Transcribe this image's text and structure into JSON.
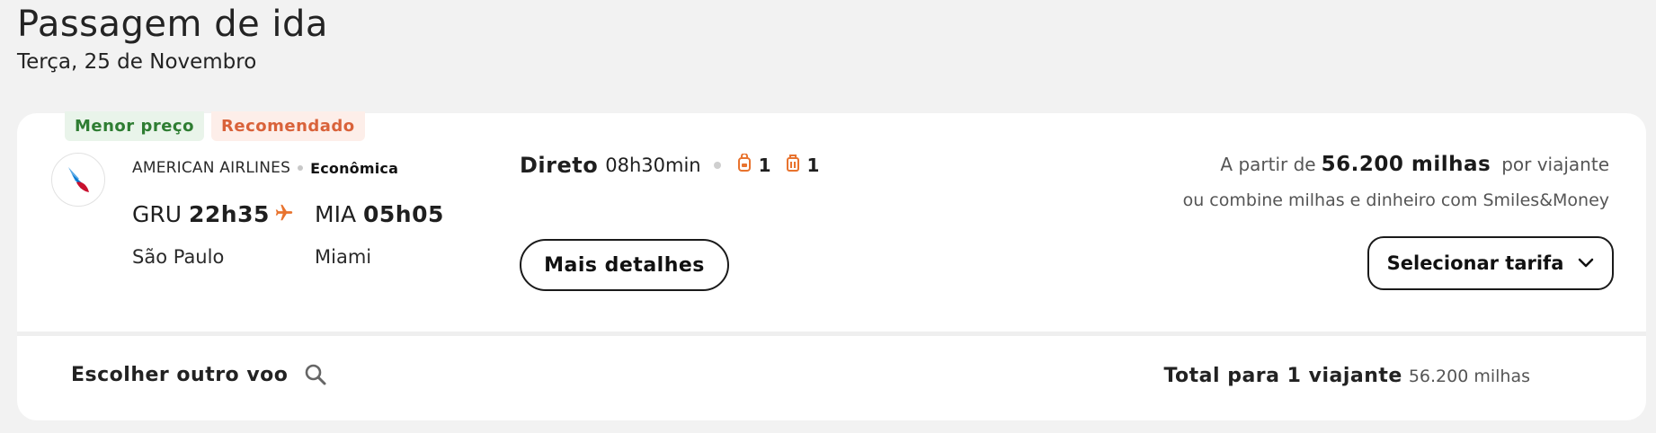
{
  "header": {
    "title": "Passagem de ida",
    "date": "Terça, 25 de Novembro"
  },
  "flight": {
    "badges": {
      "lowest_price": "Menor preço",
      "recommended": "Recomendado"
    },
    "airline": "AMERICAN AIRLINES",
    "cabin": "Econômica",
    "origin": {
      "code": "GRU",
      "time": "22h35",
      "city": "São Paulo"
    },
    "destination": {
      "code": "MIA",
      "time": "05h05",
      "city": "Miami"
    },
    "stops": "Direto",
    "duration": "08h30min",
    "baggage": {
      "carry_on": "1",
      "checked": "1"
    },
    "details_button": "Mais detalhes",
    "price": {
      "prefix": "A partir de",
      "amount": "56.200 milhas",
      "suffix": "por viajante",
      "combine_text": "ou combine milhas e dinheiro com Smiles&Money"
    },
    "select_button": "Selecionar tarifa"
  },
  "footer": {
    "other_flight": "Escolher outro voo",
    "total_label": "Total para 1 viajante",
    "total_value": "56.200 milhas"
  },
  "colors": {
    "accent": "#e8732e",
    "green_badge_bg": "#e9f4ea",
    "green_badge_text": "#2e7d32",
    "orange_badge_bg": "#fdeee9",
    "orange_badge_text": "#d9623a",
    "airline_red": "#c8102e",
    "airline_blue": "#0078d2"
  },
  "icons": [
    "airline-logo-icon",
    "plane-icon",
    "backpack-icon",
    "suitcase-icon",
    "chevron-down-icon",
    "search-icon"
  ]
}
